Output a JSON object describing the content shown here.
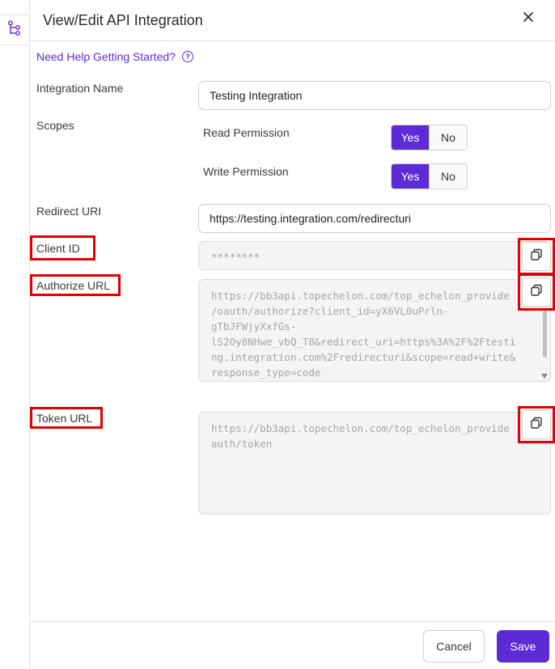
{
  "rail": {
    "icon": "workflow-tree-icon"
  },
  "header": {
    "title": "View/Edit API Integration",
    "close_icon": "close-icon"
  },
  "help": {
    "link": "Need Help Getting Started?",
    "icon": "question-circle-icon"
  },
  "form": {
    "integration_name_label": "Integration Name",
    "integration_name_value": "Testing Integration",
    "scopes_label": "Scopes",
    "read_permission_label": "Read Permission",
    "write_permission_label": "Write Permission",
    "yes_label": "Yes",
    "no_label": "No",
    "read_permission_selected": "Yes",
    "write_permission_selected": "Yes",
    "redirect_uri_label": "Redirect URI",
    "redirect_uri_value": "https://testing.integration.com/redirecturi",
    "client_id_label": "Client ID",
    "client_id_value": "********",
    "authorize_url_label": "Authorize URL",
    "authorize_url_value": "https://bb3api.topechelon.com/top_echelon_provide\n/oauth/authorize?client_id=yX6VL0uPrln-\ngTbJFWjyXxfGs-\nlS2Oy8NHwe_vbQ_T8&redirect_uri=https%3A%2F%2Ftesti\nng.integration.com%2Fredirecturi&scope=read+write&\nresponse_type=code",
    "token_url_label": "Token URL",
    "token_url_value": "https://bb3api.topechelon.com/top_echelon_provide\nauth/token",
    "copy_icon": "copy-icon"
  },
  "footer": {
    "cancel_label": "Cancel",
    "save_label": "Save"
  },
  "colors": {
    "accent": "#5d2bd5",
    "highlight": "#e30000"
  }
}
